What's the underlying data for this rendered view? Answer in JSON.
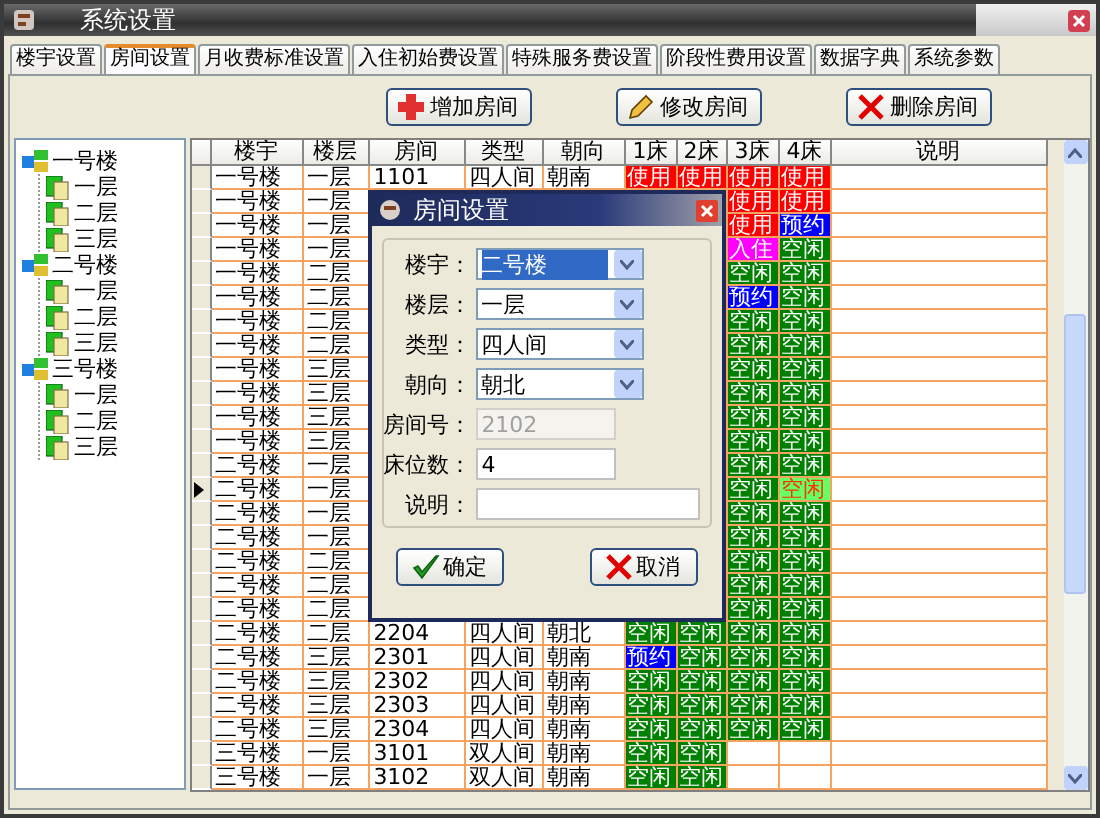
{
  "window": {
    "title": "系统设置"
  },
  "tabs": [
    {
      "label": "楼宇设置",
      "selected": false
    },
    {
      "label": "房间设置",
      "selected": true
    },
    {
      "label": "月收费标准设置",
      "selected": false
    },
    {
      "label": "入住初始费设置",
      "selected": false
    },
    {
      "label": "特殊服务费设置",
      "selected": false
    },
    {
      "label": "阶段性费用设置",
      "selected": false
    },
    {
      "label": "数据字典",
      "selected": false
    },
    {
      "label": "系统参数",
      "selected": false
    }
  ],
  "toolbar": [
    {
      "label": "增加房间",
      "kind": "add"
    },
    {
      "label": "修改房间",
      "kind": "edit"
    },
    {
      "label": "删除房间",
      "kind": "delete"
    }
  ],
  "tree": [
    {
      "label": "一号楼",
      "children": [
        {
          "label": "一层"
        },
        {
          "label": "二层"
        },
        {
          "label": "三层"
        }
      ]
    },
    {
      "label": "二号楼",
      "children": [
        {
          "label": "一层"
        },
        {
          "label": "二层"
        },
        {
          "label": "三层"
        }
      ]
    },
    {
      "label": "三号楼",
      "children": [
        {
          "label": "一层"
        },
        {
          "label": "二层"
        },
        {
          "label": "三层"
        }
      ]
    }
  ],
  "table": {
    "columns": [
      "楼宇",
      "楼层",
      "房间",
      "类型",
      "朝向",
      "1床",
      "2床",
      "3床",
      "4床",
      "说明"
    ],
    "rows": [
      {
        "selected": false,
        "building": "一号楼",
        "floor": "一层",
        "room": "1101",
        "type": "四人间",
        "facing": "朝南",
        "bed_1": {
          "text": "使用",
          "kind": "used"
        },
        "bed_2": {
          "text": "使用",
          "kind": "used"
        },
        "bed_3": {
          "text": "使用",
          "kind": "used"
        },
        "bed_4": {
          "text": "使用",
          "kind": "used"
        }
      },
      {
        "selected": false,
        "building": "一号楼",
        "floor": "一层",
        "bed_3": {
          "text": "使用",
          "kind": "used"
        },
        "bed_4": {
          "text": "使用",
          "kind": "used"
        }
      },
      {
        "selected": false,
        "building": "一号楼",
        "floor": "一层",
        "bed_3": {
          "text": "使用",
          "kind": "used"
        },
        "bed_4": {
          "text": "预约",
          "kind": "reserved"
        }
      },
      {
        "selected": false,
        "building": "一号楼",
        "floor": "一层",
        "bed_3": {
          "text": "入住",
          "kind": "checkin"
        },
        "bed_4": {
          "text": "空闲",
          "kind": "free"
        }
      },
      {
        "selected": false,
        "building": "一号楼",
        "floor": "二层",
        "bed_3": {
          "text": "空闲",
          "kind": "free"
        },
        "bed_4": {
          "text": "空闲",
          "kind": "free"
        }
      },
      {
        "selected": false,
        "building": "一号楼",
        "floor": "二层",
        "bed_3": {
          "text": "预约",
          "kind": "reserved"
        },
        "bed_4": {
          "text": "空闲",
          "kind": "free"
        }
      },
      {
        "selected": false,
        "building": "一号楼",
        "floor": "二层",
        "bed_3": {
          "text": "空闲",
          "kind": "free"
        },
        "bed_4": {
          "text": "空闲",
          "kind": "free"
        }
      },
      {
        "selected": false,
        "building": "一号楼",
        "floor": "二层",
        "bed_3": {
          "text": "空闲",
          "kind": "free"
        },
        "bed_4": {
          "text": "空闲",
          "kind": "free"
        }
      },
      {
        "selected": false,
        "building": "一号楼",
        "floor": "三层",
        "bed_3": {
          "text": "空闲",
          "kind": "free"
        },
        "bed_4": {
          "text": "空闲",
          "kind": "free"
        }
      },
      {
        "selected": false,
        "building": "一号楼",
        "floor": "三层",
        "bed_3": {
          "text": "空闲",
          "kind": "free"
        },
        "bed_4": {
          "text": "空闲",
          "kind": "free"
        }
      },
      {
        "selected": false,
        "building": "一号楼",
        "floor": "三层",
        "bed_3": {
          "text": "空闲",
          "kind": "free"
        },
        "bed_4": {
          "text": "空闲",
          "kind": "free"
        }
      },
      {
        "selected": false,
        "building": "一号楼",
        "floor": "三层",
        "bed_3": {
          "text": "空闲",
          "kind": "free"
        },
        "bed_4": {
          "text": "空闲",
          "kind": "free"
        }
      },
      {
        "selected": false,
        "building": "二号楼",
        "floor": "一层",
        "bed_3": {
          "text": "空闲",
          "kind": "free"
        },
        "bed_4": {
          "text": "空闲",
          "kind": "free"
        }
      },
      {
        "selected": true,
        "building": "二号楼",
        "floor": "一层",
        "bed_3": {
          "text": "空闲",
          "kind": "free"
        },
        "bed_4": {
          "text": "空闲",
          "kind": "current"
        }
      },
      {
        "selected": false,
        "building": "二号楼",
        "floor": "一层",
        "bed_3": {
          "text": "空闲",
          "kind": "free"
        },
        "bed_4": {
          "text": "空闲",
          "kind": "free"
        }
      },
      {
        "selected": false,
        "building": "二号楼",
        "floor": "一层",
        "bed_3": {
          "text": "空闲",
          "kind": "free"
        },
        "bed_4": {
          "text": "空闲",
          "kind": "free"
        }
      },
      {
        "selected": false,
        "building": "二号楼",
        "floor": "二层",
        "bed_3": {
          "text": "空闲",
          "kind": "free"
        },
        "bed_4": {
          "text": "空闲",
          "kind": "free"
        }
      },
      {
        "selected": false,
        "building": "二号楼",
        "floor": "二层",
        "bed_3": {
          "text": "空闲",
          "kind": "free"
        },
        "bed_4": {
          "text": "空闲",
          "kind": "free"
        }
      },
      {
        "selected": false,
        "building": "二号楼",
        "floor": "二层",
        "bed_3": {
          "text": "空闲",
          "kind": "free"
        },
        "bed_4": {
          "text": "空闲",
          "kind": "free"
        }
      },
      {
        "selected": false,
        "building": "二号楼",
        "floor": "二层",
        "room": "2204",
        "type": "四人间",
        "facing": "朝北",
        "bed_1": {
          "text": "空闲",
          "kind": "free"
        },
        "bed_2": {
          "text": "空闲",
          "kind": "free"
        },
        "bed_3": {
          "text": "空闲",
          "kind": "free"
        },
        "bed_4": {
          "text": "空闲",
          "kind": "free"
        }
      },
      {
        "selected": false,
        "building": "二号楼",
        "floor": "三层",
        "room": "2301",
        "type": "四人间",
        "facing": "朝南",
        "bed_1": {
          "text": "预约",
          "kind": "reserved"
        },
        "bed_2": {
          "text": "空闲",
          "kind": "free"
        },
        "bed_3": {
          "text": "空闲",
          "kind": "free"
        },
        "bed_4": {
          "text": "空闲",
          "kind": "free"
        }
      },
      {
        "selected": false,
        "building": "二号楼",
        "floor": "三层",
        "room": "2302",
        "type": "四人间",
        "facing": "朝南",
        "bed_1": {
          "text": "空闲",
          "kind": "free"
        },
        "bed_2": {
          "text": "空闲",
          "kind": "free"
        },
        "bed_3": {
          "text": "空闲",
          "kind": "free"
        },
        "bed_4": {
          "text": "空闲",
          "kind": "free"
        }
      },
      {
        "selected": false,
        "building": "二号楼",
        "floor": "三层",
        "room": "2303",
        "type": "四人间",
        "facing": "朝南",
        "bed_1": {
          "text": "空闲",
          "kind": "free"
        },
        "bed_2": {
          "text": "空闲",
          "kind": "free"
        },
        "bed_3": {
          "text": "空闲",
          "kind": "free"
        },
        "bed_4": {
          "text": "空闲",
          "kind": "free"
        }
      },
      {
        "selected": false,
        "building": "二号楼",
        "floor": "三层",
        "room": "2304",
        "type": "四人间",
        "facing": "朝南",
        "bed_1": {
          "text": "空闲",
          "kind": "free"
        },
        "bed_2": {
          "text": "空闲",
          "kind": "free"
        },
        "bed_3": {
          "text": "空闲",
          "kind": "free"
        },
        "bed_4": {
          "text": "空闲",
          "kind": "free"
        }
      },
      {
        "selected": false,
        "building": "三号楼",
        "floor": "一层",
        "room": "3101",
        "type": "双人间",
        "facing": "朝南",
        "bed_1": {
          "text": "空闲",
          "kind": "free"
        },
        "bed_2": {
          "text": "空闲",
          "kind": "free"
        }
      },
      {
        "selected": false,
        "building": "三号楼",
        "floor": "一层",
        "room": "3102",
        "type": "双人间",
        "facing": "朝南",
        "bed_1": {
          "text": "空闲",
          "kind": "free"
        },
        "bed_2": {
          "text": "空闲",
          "kind": "free"
        }
      }
    ]
  },
  "dialog": {
    "title": "房间设置",
    "fields": [
      {
        "label": "楼宇：",
        "kind": "select",
        "value": "二号楼",
        "highlighted": true
      },
      {
        "label": "楼层：",
        "kind": "select",
        "value": "一层",
        "highlighted": false
      },
      {
        "label": "类型：",
        "kind": "select",
        "value": "四人间",
        "highlighted": false
      },
      {
        "label": "朝向：",
        "kind": "select",
        "value": "朝北",
        "highlighted": false
      },
      {
        "label": "房间号：",
        "kind": "text",
        "value": "2102",
        "disabled": true
      },
      {
        "label": "床位数：",
        "kind": "text",
        "value": "4",
        "disabled": false
      },
      {
        "label": "说明：",
        "kind": "wide",
        "disabled": false
      }
    ],
    "buttons": [
      {
        "label": "确定",
        "kind": "ok"
      },
      {
        "label": "取消",
        "kind": "cancel"
      }
    ]
  }
}
